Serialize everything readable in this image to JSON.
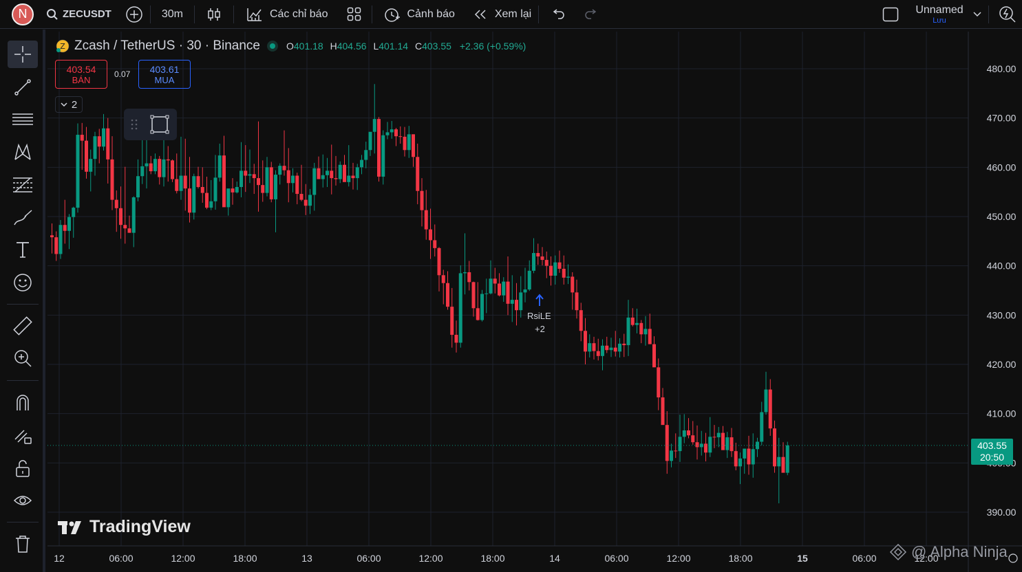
{
  "topbar": {
    "avatar_letter": "N",
    "symbol": "ZECUSDT",
    "interval": "30m",
    "indicators_label": "Các chỉ báo",
    "alerts_label": "Cảnh báo",
    "replay_label": "Xem lại",
    "layout_name": "Unnamed",
    "save_label": "Lưu"
  },
  "legend": {
    "title": "Zcash / TetherUS · 30 · Binance",
    "o_label": "O",
    "o": "401.18",
    "h_label": "H",
    "h": "404.56",
    "l_label": "L",
    "l": "401.14",
    "c_label": "C",
    "c": "403.55",
    "change": "+2.36 (+0.59%)"
  },
  "trade": {
    "sell_price": "403.54",
    "sell_label": "BÁN",
    "spread": "0.07",
    "buy_price": "403.61",
    "buy_label": "MUA"
  },
  "indicator_toggle": "2",
  "price_tag": {
    "price": "403.55",
    "countdown": "20:50"
  },
  "signal": {
    "label": "RsiLE",
    "count": "+2"
  },
  "branding": {
    "logo_text": "TradingView",
    "watermark": "@ Alpha Ninja"
  },
  "colors": {
    "up": "#089981",
    "down": "#f23645",
    "background": "#0f0f0f",
    "grid": "#1e222d",
    "text": "#d1d4dc"
  },
  "chart_data": {
    "type": "candlestick",
    "ylim": [
      386,
      484
    ],
    "y_ticks": [
      480,
      470,
      460,
      450,
      440,
      430,
      420,
      410,
      400,
      390
    ],
    "x_ticks": [
      "12",
      "06:00",
      "12:00",
      "18:00",
      "13",
      "06:00",
      "12:00",
      "18:00",
      "14",
      "06:00",
      "12:00",
      "18:00",
      "15",
      "06:00",
      "12:00"
    ],
    "last_price": 403.55,
    "candles": [
      [
        446.2,
        448.6,
        442.5,
        445.8
      ],
      [
        445.8,
        447.0,
        441.0,
        442.4
      ],
      [
        442.4,
        449.3,
        441.4,
        448.3
      ],
      [
        448.3,
        453.4,
        444.5,
        447.1
      ],
      [
        447.1,
        450.5,
        443.4,
        449.9
      ],
      [
        449.9,
        452.0,
        445.7,
        451.8
      ],
      [
        451.8,
        468.9,
        450.8,
        466.6
      ],
      [
        466.6,
        469.0,
        459.5,
        465.4
      ],
      [
        465.4,
        468.2,
        457.7,
        459.1
      ],
      [
        459.1,
        463.6,
        455.1,
        461.7
      ],
      [
        461.7,
        467.2,
        458.3,
        466.3
      ],
      [
        466.3,
        467.8,
        460.8,
        464.2
      ],
      [
        464.2,
        470.8,
        463.4,
        467.9
      ],
      [
        467.9,
        470.0,
        456.7,
        461.6
      ],
      [
        461.6,
        466.3,
        451.3,
        453.4
      ],
      [
        453.4,
        455.3,
        446.9,
        451.7
      ],
      [
        451.7,
        456.1,
        445.5,
        448.3
      ],
      [
        448.3,
        460.1,
        444.5,
        447.6
      ],
      [
        447.6,
        450.2,
        446.7,
        446.7
      ],
      [
        446.7,
        454.1,
        443.8,
        453.9
      ],
      [
        453.9,
        461.6,
        453.1,
        458.2
      ],
      [
        458.2,
        466.1,
        456.6,
        460.2
      ],
      [
        460.2,
        467.9,
        455.7,
        460.8
      ],
      [
        460.8,
        462.3,
        458.6,
        459.2
      ],
      [
        459.2,
        462.8,
        458.6,
        461.7
      ],
      [
        461.7,
        462.3,
        456.5,
        458.0
      ],
      [
        458.0,
        465.6,
        456.1,
        461.6
      ],
      [
        461.6,
        464.3,
        457.1,
        461.4
      ],
      [
        461.4,
        461.6,
        457.0,
        457.6
      ],
      [
        457.6,
        462.8,
        454.7,
        455.2
      ],
      [
        455.2,
        466.2,
        453.4,
        458.3
      ],
      [
        458.3,
        465.8,
        451.2,
        455.7
      ],
      [
        455.7,
        462.1,
        448.8,
        450.8
      ],
      [
        450.8,
        458.7,
        449.4,
        458.2
      ],
      [
        458.2,
        460.1,
        455.7,
        456.0
      ],
      [
        456.0,
        460.0,
        452.8,
        454.8
      ],
      [
        454.8,
        458.1,
        451.5,
        451.8
      ],
      [
        451.8,
        457.4,
        451.3,
        453.1
      ],
      [
        453.1,
        462.5,
        451.4,
        457.9
      ],
      [
        457.9,
        464.8,
        457.1,
        462.4
      ],
      [
        462.4,
        466.4,
        455.7,
        451.9
      ],
      [
        451.9,
        454.8,
        450.2,
        455.7
      ],
      [
        455.7,
        457.8,
        452.4,
        454.9
      ],
      [
        454.9,
        457.1,
        454.7,
        456.0
      ],
      [
        456.0,
        465.1,
        453.9,
        459.3
      ],
      [
        459.3,
        464.5,
        455.0,
        458.3
      ],
      [
        458.3,
        463.6,
        456.8,
        458.6
      ],
      [
        458.6,
        460.7,
        454.6,
        457.8
      ],
      [
        457.8,
        469.3,
        451.0,
        456.4
      ],
      [
        456.4,
        461.4,
        453.0,
        454.8
      ],
      [
        454.8,
        462.1,
        454.1,
        460.0
      ],
      [
        460.0,
        461.1,
        452.9,
        453.5
      ],
      [
        453.5,
        459.4,
        446.8,
        458.5
      ],
      [
        458.5,
        460.8,
        456.5,
        460.3
      ],
      [
        460.3,
        467.5,
        458.3,
        459.4
      ],
      [
        459.4,
        463.9,
        452.9,
        456.8
      ],
      [
        456.8,
        459.8,
        454.9,
        458.3
      ],
      [
        458.3,
        458.9,
        452.5,
        454.6
      ],
      [
        454.6,
        460.5,
        453.1,
        453.4
      ],
      [
        453.4,
        456.6,
        450.3,
        452.2
      ],
      [
        452.2,
        455.6,
        450.5,
        454.4
      ],
      [
        454.4,
        460.9,
        451.2,
        459.8
      ],
      [
        459.8,
        462.2,
        457.7,
        457.6
      ],
      [
        457.6,
        462.6,
        455.9,
        458.4
      ],
      [
        458.4,
        461.9,
        456.0,
        459.3
      ],
      [
        459.3,
        464.6,
        454.5,
        457.8
      ],
      [
        457.8,
        462.3,
        456.3,
        457.6
      ],
      [
        457.6,
        461.2,
        456.8,
        460.5
      ],
      [
        460.5,
        462.5,
        457.5,
        457.0
      ],
      [
        457.0,
        464.5,
        456.1,
        458.3
      ],
      [
        458.3,
        460.9,
        455.5,
        457.8
      ],
      [
        457.8,
        460.7,
        455.4,
        460.0
      ],
      [
        460.0,
        462.5,
        458.6,
        461.5
      ],
      [
        461.5,
        465.2,
        459.8,
        463.5
      ],
      [
        463.5,
        466.6,
        462.3,
        467.2
      ],
      [
        467.2,
        476.9,
        462.8,
        469.8
      ],
      [
        469.8,
        470.2,
        457.1,
        458.1
      ],
      [
        458.1,
        467.5,
        456.5,
        466.5
      ],
      [
        466.5,
        469.2,
        465.7,
        467.1
      ],
      [
        467.1,
        469.4,
        465.8,
        467.7
      ],
      [
        467.7,
        468.0,
        464.3,
        466.3
      ],
      [
        466.3,
        468.3,
        464.8,
        466.2
      ],
      [
        466.2,
        468.2,
        462.2,
        463.5
      ],
      [
        463.5,
        468.4,
        461.9,
        466.7
      ],
      [
        466.7,
        466.7,
        460.1,
        462.1
      ],
      [
        462.1,
        464.8,
        452.5,
        455.2
      ],
      [
        455.2,
        457.8,
        448.0,
        451.3
      ],
      [
        451.3,
        455.4,
        445.3,
        447.4
      ],
      [
        447.4,
        451.6,
        441.4,
        445.2
      ],
      [
        445.2,
        448.4,
        441.9,
        443.6
      ],
      [
        443.6,
        443.8,
        434.8,
        438.1
      ],
      [
        438.1,
        439.2,
        432.2,
        436.5
      ],
      [
        436.5,
        438.9,
        431.1,
        431.7
      ],
      [
        431.7,
        435.5,
        423.4,
        426.0
      ],
      [
        426.0,
        428.9,
        422.4,
        424.4
      ],
      [
        424.4,
        440.1,
        423.4,
        438.5
      ],
      [
        438.5,
        446.6,
        434.2,
        438.7
      ],
      [
        438.7,
        441.0,
        435.0,
        436.7
      ],
      [
        436.7,
        436.8,
        429.7,
        431.4
      ],
      [
        431.4,
        436.7,
        428.9,
        429.0
      ],
      [
        429.0,
        435.1,
        428.7,
        434.3
      ],
      [
        434.3,
        437.4,
        430.4,
        434.4
      ],
      [
        434.4,
        441.1,
        434.2,
        437.4
      ],
      [
        437.4,
        439.6,
        434.4,
        436.4
      ],
      [
        436.4,
        438.5,
        433.8,
        434.0
      ],
      [
        434.0,
        437.7,
        432.7,
        436.8
      ],
      [
        436.8,
        441.9,
        430.0,
        432.3
      ],
      [
        432.3,
        438.1,
        428.6,
        433.1
      ],
      [
        433.1,
        436.5,
        427.9,
        431.0
      ],
      [
        431.0,
        437.9,
        429.5,
        434.6
      ],
      [
        434.6,
        439.6,
        432.6,
        435.2
      ],
      [
        435.2,
        441.1,
        434.9,
        439.0
      ],
      [
        439.0,
        445.6,
        438.5,
        442.6
      ],
      [
        442.6,
        444.5,
        440.2,
        441.9
      ],
      [
        441.9,
        443.8,
        440.1,
        441.2
      ],
      [
        441.2,
        442.9,
        437.5,
        440.0
      ],
      [
        440.0,
        441.9,
        436.0,
        438.0
      ],
      [
        438.0,
        442.1,
        436.2,
        440.7
      ],
      [
        440.7,
        443.1,
        438.6,
        439.4
      ],
      [
        439.4,
        442.1,
        436.2,
        437.6
      ],
      [
        437.6,
        440.3,
        436.3,
        437.8
      ],
      [
        437.8,
        438.7,
        431.1,
        434.6
      ],
      [
        434.6,
        437.2,
        429.3,
        431.0
      ],
      [
        431.0,
        432.5,
        424.7,
        426.8
      ],
      [
        426.8,
        429.4,
        420.0,
        422.6
      ],
      [
        422.6,
        426.1,
        421.4,
        424.3
      ],
      [
        424.3,
        425.6,
        421.0,
        422.7
      ],
      [
        422.7,
        425.2,
        420.8,
        421.7
      ],
      [
        421.7,
        425.1,
        418.8,
        423.8
      ],
      [
        423.8,
        425.6,
        422.3,
        422.9
      ],
      [
        422.9,
        425.4,
        421.5,
        423.4
      ],
      [
        423.4,
        426.8,
        421.6,
        422.6
      ],
      [
        422.6,
        425.3,
        421.4,
        424.2
      ],
      [
        424.2,
        426.2,
        421.5,
        423.9
      ],
      [
        423.9,
        433.1,
        421.7,
        429.5
      ],
      [
        429.5,
        431.4,
        427.7,
        428.0
      ],
      [
        428.0,
        431.3,
        426.3,
        428.4
      ],
      [
        428.4,
        429.0,
        424.3,
        426.1
      ],
      [
        426.1,
        429.8,
        423.8,
        427.2
      ],
      [
        427.2,
        430.3,
        424.7,
        424.1
      ],
      [
        424.1,
        425.7,
        420.2,
        419.4
      ],
      [
        419.4,
        421.2,
        410.7,
        413.3
      ],
      [
        413.3,
        415.2,
        409.5,
        407.7
      ],
      [
        407.7,
        410.5,
        397.8,
        400.4
      ],
      [
        400.4,
        403.9,
        399.1,
        402.5
      ],
      [
        402.5,
        406.0,
        401.0,
        402.4
      ],
      [
        402.4,
        409.8,
        400.2,
        405.3
      ],
      [
        405.3,
        409.9,
        404.0,
        406.6
      ],
      [
        406.6,
        409.1,
        405.0,
        405.6
      ],
      [
        405.6,
        408.5,
        403.7,
        404.2
      ],
      [
        404.2,
        407.6,
        400.7,
        403.2
      ],
      [
        403.2,
        406.5,
        401.5,
        403.9
      ],
      [
        403.9,
        406.1,
        400.3,
        402.1
      ],
      [
        402.1,
        409.3,
        401.2,
        405.3
      ],
      [
        405.3,
        407.7,
        403.0,
        405.2
      ],
      [
        405.2,
        407.3,
        403.2,
        406.1
      ],
      [
        406.1,
        407.5,
        402.7,
        402.6
      ],
      [
        402.6,
        406.3,
        401.0,
        405.2
      ],
      [
        405.2,
        407.1,
        401.2,
        402.4
      ],
      [
        402.4,
        404.1,
        398.5,
        399.3
      ],
      [
        399.3,
        402.1,
        395.7,
        400.9
      ],
      [
        400.9,
        402.4,
        397.8,
        402.9
      ],
      [
        402.9,
        405.5,
        397.6,
        399.7
      ],
      [
        399.7,
        406.0,
        397.0,
        402.8
      ],
      [
        402.8,
        405.1,
        401.2,
        404.3
      ],
      [
        404.3,
        412.4,
        403.6,
        410.3
      ],
      [
        410.3,
        418.5,
        409.8,
        414.9
      ],
      [
        414.9,
        417.0,
        405.5,
        407.0
      ],
      [
        407.0,
        408.6,
        398.0,
        399.3
      ],
      [
        399.3,
        405.1,
        391.8,
        401.2
      ],
      [
        401.2,
        404.2,
        398.5,
        398.0
      ],
      [
        398.0,
        404.3,
        397.5,
        403.55
      ]
    ]
  }
}
